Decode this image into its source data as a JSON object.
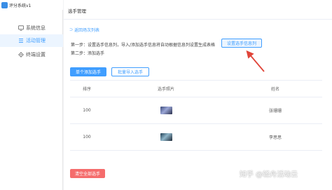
{
  "app": {
    "title": "评分系统v1"
  },
  "sidebar": {
    "items": [
      {
        "label": "系统信息",
        "icon": "monitor-icon",
        "active": false
      },
      {
        "label": "活动管理",
        "icon": "list-icon",
        "active": true
      },
      {
        "label": "终端设置",
        "icon": "gear-icon",
        "active": false
      }
    ]
  },
  "main": {
    "title": "选手管理",
    "back_link": "返回场次列表",
    "step1": "第一步：设置选手信息列，导入/添加选手信息将自动根据信息列设置生成表格",
    "step1_button": "设置选手信息列",
    "step2": "第二步：添加选手",
    "add_single_button": "单个添加选手",
    "batch_import_button": "批量导入选手",
    "clear_all_button": "清空全部选手"
  },
  "table": {
    "headers": [
      "排序",
      "选手照片",
      "姓名"
    ],
    "rows": [
      {
        "order": "100",
        "photo": "photo-thumbnail",
        "name": "张珊珊"
      },
      {
        "order": "100",
        "photo": "photo-thumbnail",
        "name": "李思思"
      }
    ]
  },
  "watermark": "知乎 @轻舟活动云",
  "colors": {
    "accent": "#409eff",
    "danger": "#f56c6c",
    "annotation": "#e0453a"
  }
}
